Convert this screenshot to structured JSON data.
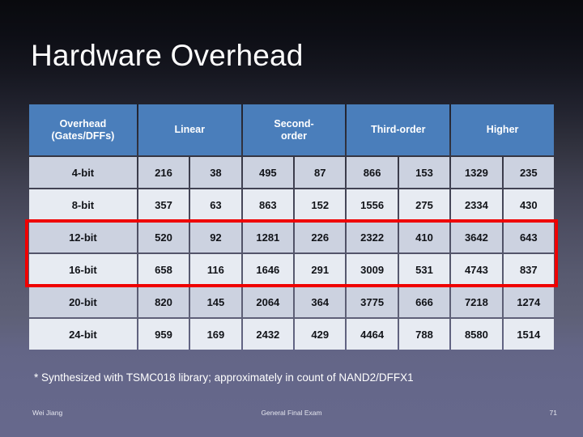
{
  "slide": {
    "title": "Hardware Overhead",
    "accent_header_color": "#4a7ebb",
    "highlight_color": "#ef0000"
  },
  "table": {
    "row_header_label": "Overhead\n(Gates/DFFs)",
    "row_header_line1": "Overhead",
    "row_header_line2": "(Gates/DFFs)",
    "group_headers": [
      {
        "line1": "Linear",
        "line2": ""
      },
      {
        "line1": "Second-",
        "line2": "order"
      },
      {
        "line1": "Third-order",
        "line2": ""
      },
      {
        "line1": "Higher",
        "line2": ""
      }
    ],
    "rows": [
      {
        "label": "4-bit",
        "values": [
          216,
          38,
          495,
          87,
          866,
          153,
          1329,
          235
        ],
        "highlighted": false
      },
      {
        "label": "8-bit",
        "values": [
          357,
          63,
          863,
          152,
          1556,
          275,
          2334,
          430
        ],
        "highlighted": false
      },
      {
        "label": "12-bit",
        "values": [
          520,
          92,
          1281,
          226,
          2322,
          410,
          3642,
          643
        ],
        "highlighted": true
      },
      {
        "label": "16-bit",
        "values": [
          658,
          116,
          1646,
          291,
          3009,
          531,
          4743,
          837
        ],
        "highlighted": true
      },
      {
        "label": "20-bit",
        "values": [
          820,
          145,
          2064,
          364,
          3775,
          666,
          7218,
          1274
        ],
        "highlighted": false
      },
      {
        "label": "24-bit",
        "values": [
          959,
          169,
          2432,
          429,
          4464,
          788,
          8580,
          1514
        ],
        "highlighted": false
      }
    ]
  },
  "footnote": "* Synthesized with TSMC018 library; approximately in count of NAND2/DFFX1",
  "footer": {
    "author": "Wei Jiang",
    "center": "General Final Exam",
    "page": "71"
  }
}
